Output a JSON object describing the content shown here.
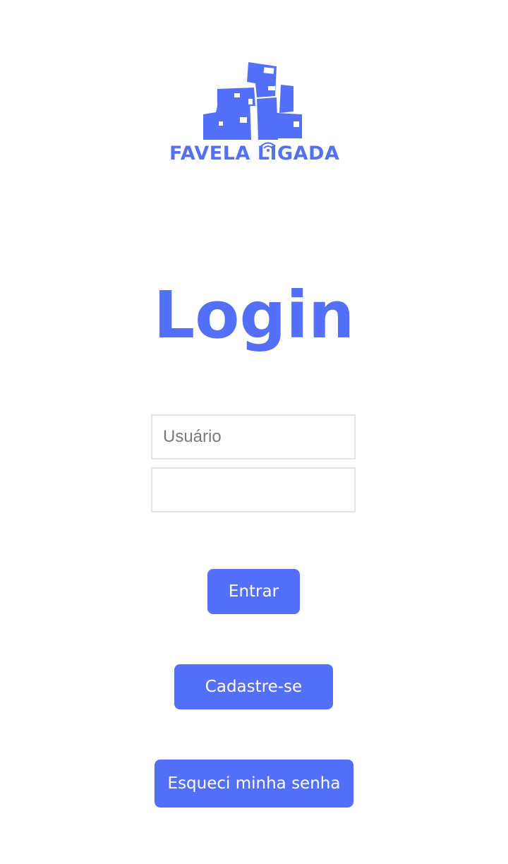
{
  "brand": {
    "logo_text": "FAVELA LIGADA",
    "color": "#5470f8"
  },
  "page": {
    "title": "Login"
  },
  "form": {
    "username_placeholder": "Usuário",
    "username_value": "",
    "password_placeholder": "",
    "password_value": ""
  },
  "buttons": {
    "enter_label": "Entrar",
    "signup_label": "Cadastre-se",
    "forgot_label": "Esqueci minha senha"
  },
  "icons": {
    "logo": "favela-houses-logo",
    "wifi": "wifi-icon"
  }
}
